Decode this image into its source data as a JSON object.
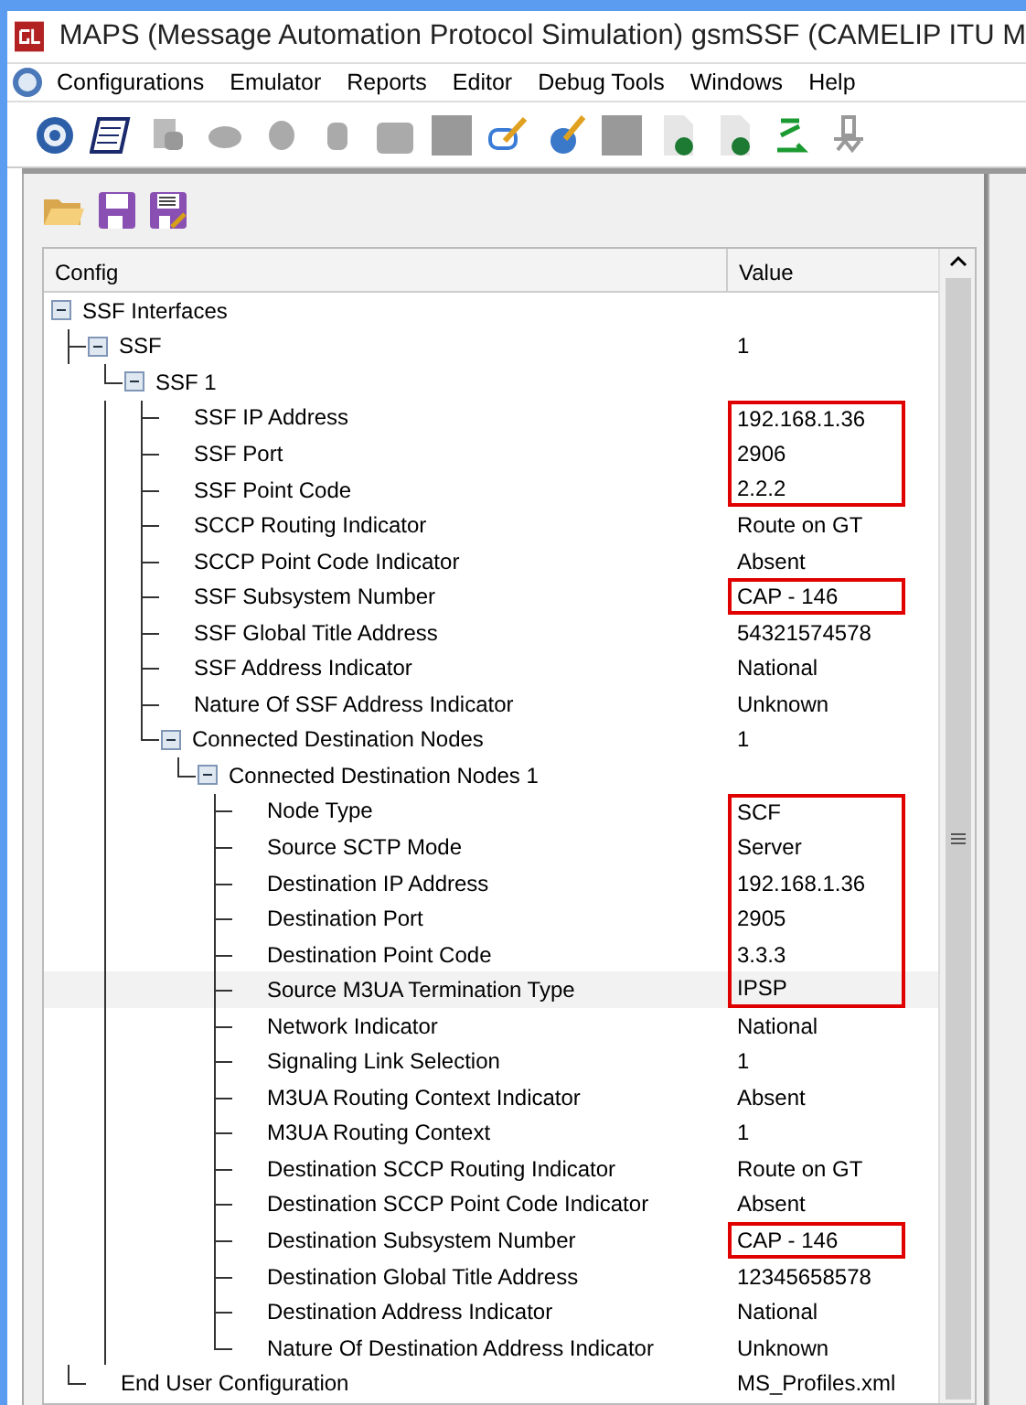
{
  "window": {
    "title": "MAPS (Message Automation Protocol Simulation) gsmSSF (CAMELIP ITU M"
  },
  "menu": [
    "Configurations",
    "Emulator",
    "Reports",
    "Editor",
    "Debug Tools",
    "Windows",
    "Help"
  ],
  "tree": {
    "columns": [
      "Config",
      "Value"
    ],
    "nodes": [
      {
        "label": "SSF Interfaces",
        "expanded": true,
        "boxed": false,
        "hovered": false,
        "children": [
          {
            "label": "SSF",
            "value": "1",
            "expanded": true,
            "boxed": false,
            "hovered": false,
            "children": [
              {
                "label": "SSF 1",
                "expanded": true,
                "boxed": false,
                "hovered": false,
                "children": [
                  {
                    "label": "SSF IP Address",
                    "value": "192.168.1.36",
                    "boxed": true,
                    "hovered": false
                  },
                  {
                    "label": "SSF Port",
                    "value": "2906",
                    "boxed": true,
                    "hovered": false
                  },
                  {
                    "label": "SSF Point Code",
                    "value": "2.2.2",
                    "boxed": true,
                    "hovered": false
                  },
                  {
                    "label": "SCCP Routing Indicator",
                    "value": "Route on GT",
                    "boxed": false,
                    "hovered": false
                  },
                  {
                    "label": "SCCP Point Code Indicator",
                    "value": "Absent",
                    "boxed": false,
                    "hovered": false
                  },
                  {
                    "label": "SSF Subsystem Number",
                    "value": "CAP - 146",
                    "boxed": true,
                    "hovered": false
                  },
                  {
                    "label": "SSF Global Title Address",
                    "value": "54321574578",
                    "boxed": false,
                    "hovered": false
                  },
                  {
                    "label": "SSF Address Indicator",
                    "value": "National",
                    "boxed": false,
                    "hovered": false
                  },
                  {
                    "label": "Nature Of SSF Address Indicator",
                    "value": "Unknown",
                    "boxed": false,
                    "hovered": false
                  },
                  {
                    "label": "Connected Destination Nodes",
                    "value": "1",
                    "expanded": true,
                    "boxed": false,
                    "hovered": false,
                    "children": [
                      {
                        "label": "Connected Destination Nodes 1",
                        "expanded": true,
                        "boxed": false,
                        "hovered": false,
                        "children": [
                          {
                            "label": "Node Type",
                            "value": "SCF",
                            "boxed": true,
                            "hovered": false
                          },
                          {
                            "label": "Source SCTP Mode",
                            "value": "Server",
                            "boxed": true,
                            "hovered": false
                          },
                          {
                            "label": "Destination IP Address",
                            "value": "192.168.1.36",
                            "boxed": true,
                            "hovered": false
                          },
                          {
                            "label": "Destination Port",
                            "value": "2905",
                            "boxed": true,
                            "hovered": false
                          },
                          {
                            "label": "Destination Point Code",
                            "value": "3.3.3",
                            "boxed": true,
                            "hovered": false
                          },
                          {
                            "label": "Source M3UA Termination Type",
                            "value": "IPSP",
                            "boxed": true,
                            "hovered": true
                          },
                          {
                            "label": "Network Indicator",
                            "value": "National",
                            "boxed": false,
                            "hovered": false
                          },
                          {
                            "label": "Signaling Link Selection",
                            "value": "1",
                            "boxed": false,
                            "hovered": false
                          },
                          {
                            "label": "M3UA Routing Context Indicator",
                            "value": "Absent",
                            "boxed": false,
                            "hovered": false
                          },
                          {
                            "label": "M3UA Routing Context",
                            "value": "1",
                            "boxed": false,
                            "hovered": false
                          },
                          {
                            "label": "Destination SCCP Routing Indicator",
                            "value": "Route on GT",
                            "boxed": false,
                            "hovered": false
                          },
                          {
                            "label": "Destination SCCP Point Code Indicator",
                            "value": "Absent",
                            "boxed": false,
                            "hovered": false
                          },
                          {
                            "label": "Destination Subsystem Number",
                            "value": "CAP - 146",
                            "boxed": true,
                            "hovered": false
                          },
                          {
                            "label": "Destination Global Title Address",
                            "value": "12345658578",
                            "boxed": false,
                            "hovered": false
                          },
                          {
                            "label": "Destination Address Indicator",
                            "value": "National",
                            "boxed": false,
                            "hovered": false
                          },
                          {
                            "label": "Nature Of Destination Address Indicator",
                            "value": "Unknown",
                            "boxed": false,
                            "hovered": false
                          }
                        ]
                      }
                    ]
                  }
                ]
              }
            ]
          },
          {
            "label": "End User Configuration",
            "value": "MS_Profiles.xml",
            "boxed": false,
            "hovered": false
          }
        ]
      }
    ]
  }
}
